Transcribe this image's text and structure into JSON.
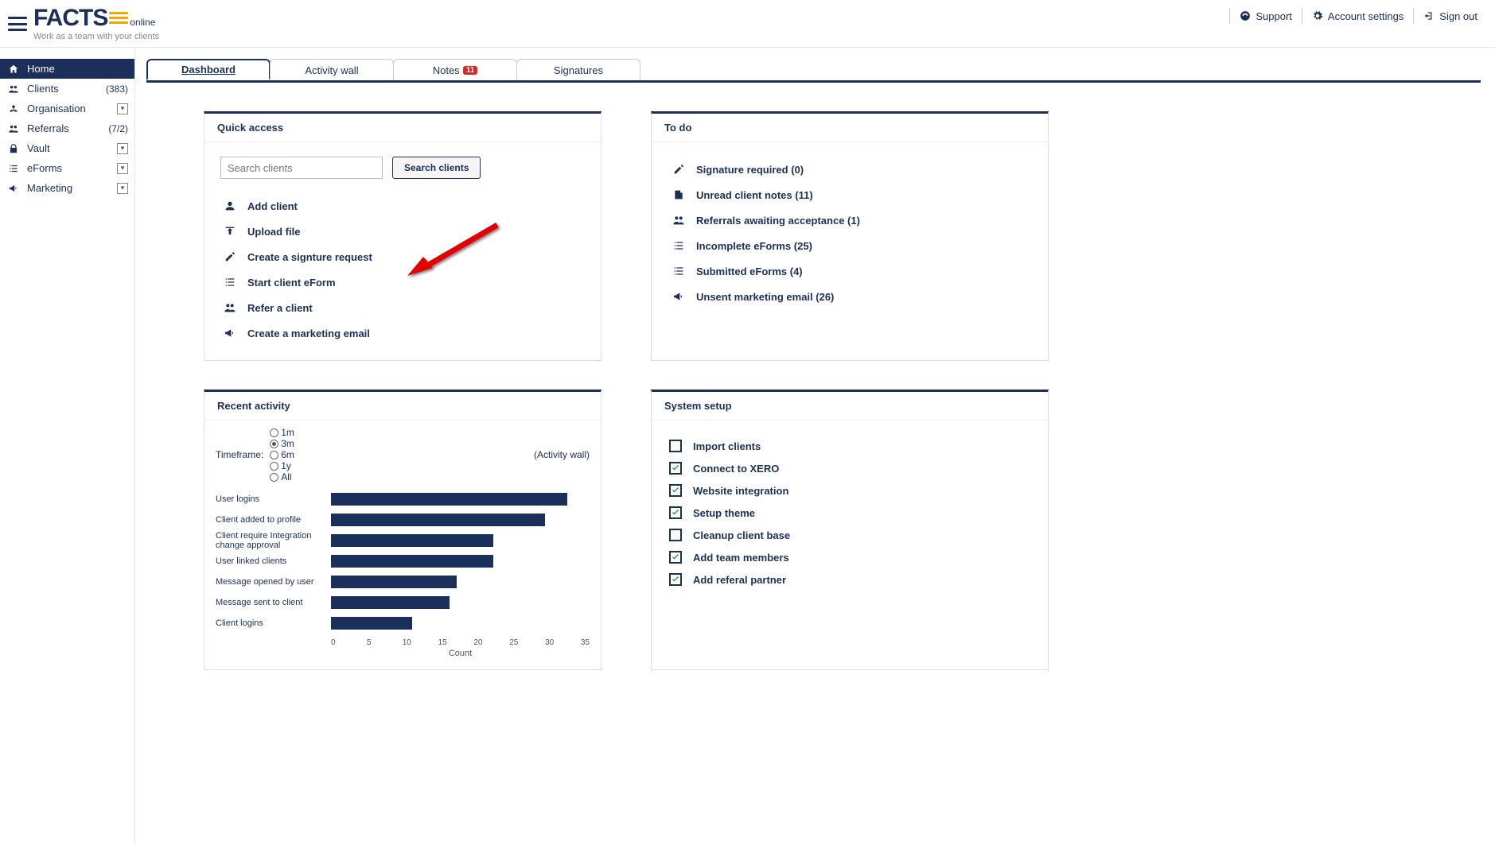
{
  "logo": {
    "brand": "FACTS",
    "suffix": "online",
    "tagline": "Work as a team with your clients"
  },
  "header": {
    "support": "Support",
    "account": "Account settings",
    "signout": "Sign out"
  },
  "sidebar": {
    "items": [
      {
        "label": "Home",
        "icon": "home",
        "active": true
      },
      {
        "label": "Clients",
        "icon": "users",
        "right": "(383)"
      },
      {
        "label": "Organisation",
        "icon": "org",
        "expandable": true
      },
      {
        "label": "Referrals",
        "icon": "users",
        "right": "(7/2)"
      },
      {
        "label": "Vault",
        "icon": "lock",
        "expandable": true
      },
      {
        "label": "eForms",
        "icon": "list",
        "expandable": true
      },
      {
        "label": "Marketing",
        "icon": "bullhorn",
        "expandable": true
      }
    ]
  },
  "tabs": [
    {
      "label": "Dashboard",
      "active": true
    },
    {
      "label": "Activity wall"
    },
    {
      "label": "Notes",
      "badge": "11"
    },
    {
      "label": "Signatures"
    }
  ],
  "quickAccess": {
    "title": "Quick access",
    "searchPlaceholder": "Search clients",
    "searchButton": "Search clients",
    "items": [
      {
        "label": "Add client",
        "icon": "user"
      },
      {
        "label": "Upload file",
        "icon": "upload"
      },
      {
        "label": "Create a signture request",
        "icon": "edit"
      },
      {
        "label": "Start client eForm",
        "icon": "list"
      },
      {
        "label": "Refer a client",
        "icon": "users"
      },
      {
        "label": "Create a marketing email",
        "icon": "bullhorn"
      }
    ]
  },
  "todo": {
    "title": "To do",
    "items": [
      {
        "label": "Signature required (0)",
        "icon": "edit"
      },
      {
        "label": "Unread client notes (11)",
        "icon": "note"
      },
      {
        "label": "Referrals awaiting acceptance (1)",
        "icon": "users"
      },
      {
        "label": "Incomplete eForms (25)",
        "icon": "list"
      },
      {
        "label": "Submitted eForms (4)",
        "icon": "list"
      },
      {
        "label": "Unsent marketing email (26)",
        "icon": "bullhorn"
      }
    ]
  },
  "activity": {
    "title": "Recent activity",
    "timeframeLabel": "Timeframe:",
    "options": [
      "1m",
      "3m",
      "6m",
      "1y",
      "All"
    ],
    "selected": "3m",
    "activityWallLink": "(Activity wall)"
  },
  "systemSetup": {
    "title": "System setup",
    "items": [
      {
        "label": "Import clients",
        "done": false
      },
      {
        "label": "Connect to XERO",
        "done": true
      },
      {
        "label": "Website integration",
        "done": true
      },
      {
        "label": "Setup theme",
        "done": true
      },
      {
        "label": "Cleanup client base",
        "done": false
      },
      {
        "label": "Add team members",
        "done": true
      },
      {
        "label": "Add referal partner",
        "done": true
      }
    ]
  },
  "chart_data": {
    "type": "bar",
    "orientation": "horizontal",
    "categories": [
      "User logins",
      "Client added to profile",
      "Client require Integration change approval",
      "User linked clients",
      "Message opened by user",
      "Message sent to client",
      "Client logins"
    ],
    "values": [
      32,
      29,
      22,
      22,
      17,
      16,
      11
    ],
    "xlabel": "Count",
    "xlim": [
      0,
      35
    ],
    "ticks": [
      0,
      5,
      10,
      15,
      20,
      25,
      30,
      35
    ]
  }
}
